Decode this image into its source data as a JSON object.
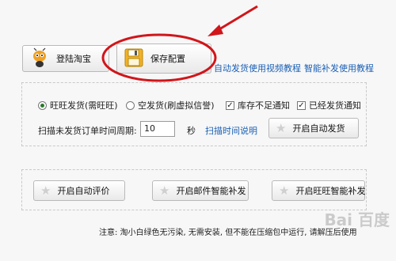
{
  "toolbar": {
    "login_label": "登陆淘宝",
    "save_label": "保存配置",
    "link_auto_ship_video": "自动发货使用视频教程",
    "link_smart_resend": "智能补发使用教程"
  },
  "shipping": {
    "radio_wangwang": "旺旺发货(需旺旺)",
    "radio_virtual": "空发货(刷虚拟信誉)",
    "check_stock": "库存不足通知",
    "check_shipped": "已经发货通知",
    "scan_label": "扫描未发货订单时间周期:",
    "scan_value": "10",
    "scan_unit": "秒",
    "scan_help_link": "扫描时间说明",
    "start_auto_ship": "开启自动发货"
  },
  "actions": {
    "auto_review": "开启自动评价",
    "email_resend": "开启邮件智能补发",
    "wangwang_resend": "开启旺旺智能补发"
  },
  "footer_note": "注意: 淘小白绿色无污染, 无需安装, 但不能在压缩包中运行, 请解压后使用",
  "watermark": "Bai 百度",
  "colors": {
    "link": "#1a5fb4",
    "annotation": "#d0161b"
  }
}
